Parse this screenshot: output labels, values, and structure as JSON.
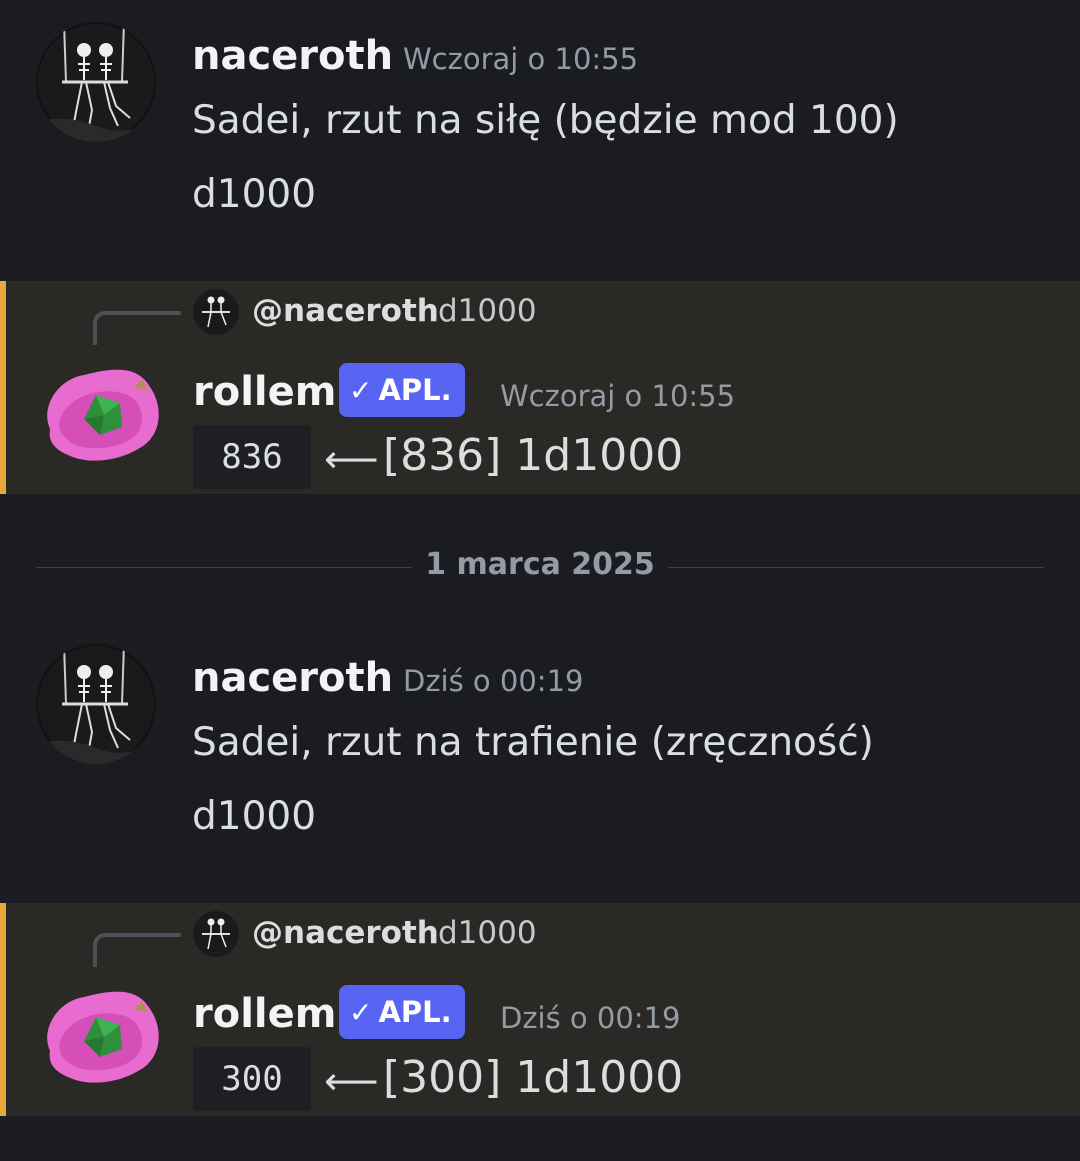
{
  "messages": [
    {
      "author": "naceroth",
      "timestamp": "Wczoraj o 10:55",
      "lines": [
        "Sadei, rzut na siłę (będzie mod 100)",
        "d1000"
      ]
    },
    {
      "reply_to": {
        "user": "@naceroth",
        "text": "d1000"
      },
      "author": "rollem",
      "badge": "APL.",
      "timestamp": "Wczoraj o 10:55",
      "code": "836",
      "arrow": "⟵",
      "result": "[836] 1d1000"
    },
    {
      "author": "naceroth",
      "timestamp": "Dziś o 00:19",
      "lines": [
        "Sadei, rzut na trafienie (zręczność)",
        "d1000"
      ]
    },
    {
      "reply_to": {
        "user": "@naceroth",
        "text": "d1000"
      },
      "author": "rollem",
      "badge": "APL.",
      "timestamp": "Dziś o 00:19",
      "code": "300",
      "arrow": "⟵",
      "result": "[300] 1d1000"
    }
  ],
  "date_divider": "1 marca 2025",
  "colors": {
    "background": "#1b1c21",
    "mention_bg": "#2a2925",
    "mention_border": "#e8a93a",
    "badge": "#5865f2"
  },
  "icons": {
    "naceroth_avatar": "skeletons-on-swing-avatar",
    "rollem_avatar": "pink-fluffy-bag-with-dice-avatar",
    "badge_check": "checkmark-icon"
  }
}
